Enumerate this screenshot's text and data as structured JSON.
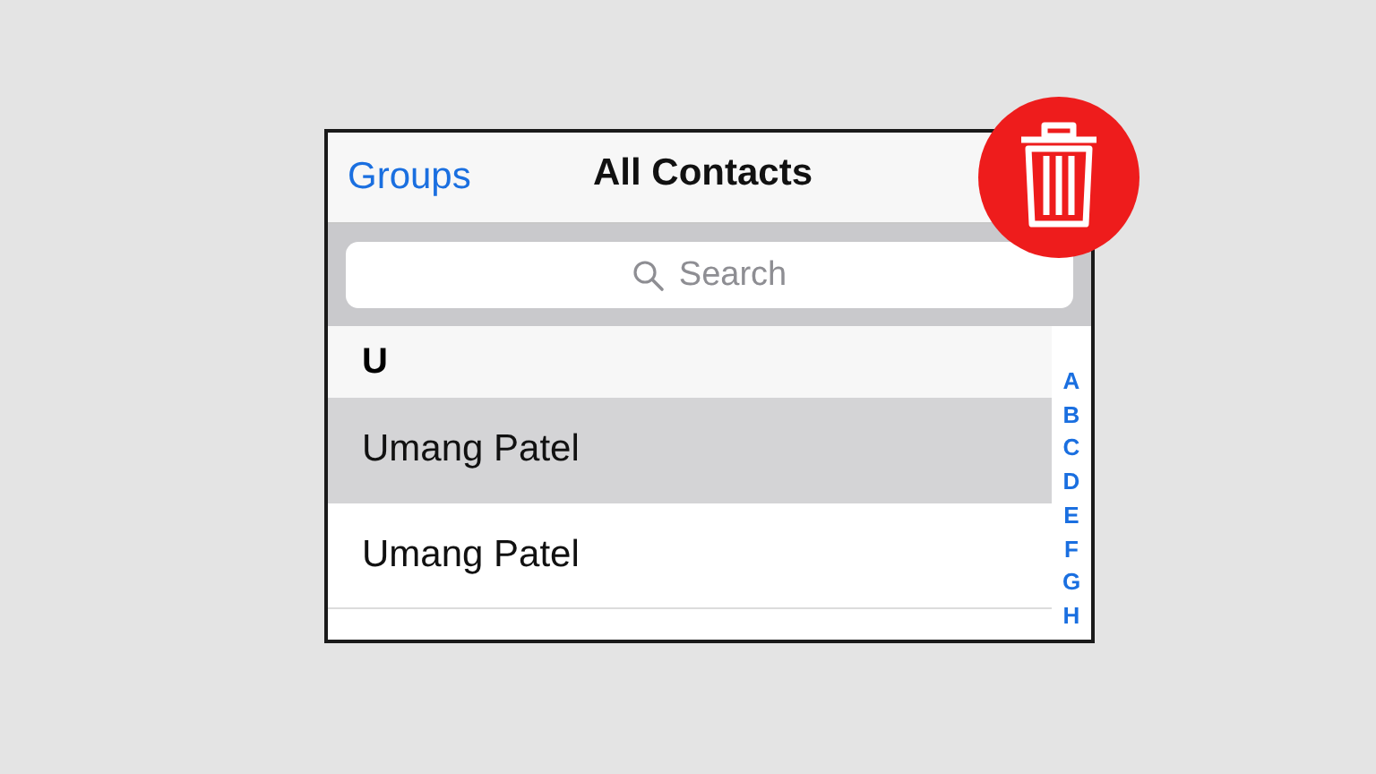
{
  "nav_bar": {
    "back_button": "Groups",
    "title": "All Contacts"
  },
  "search": {
    "placeholder": "Search"
  },
  "section_header": "U",
  "rows": [
    {
      "name": "Umang Patel",
      "selected": true
    },
    {
      "name": "Umang Patel",
      "selected": false
    }
  ],
  "index_letters": [
    "A",
    "B",
    "C",
    "D",
    "E",
    "F",
    "G",
    "H"
  ],
  "badge": {
    "kind": "trash"
  }
}
